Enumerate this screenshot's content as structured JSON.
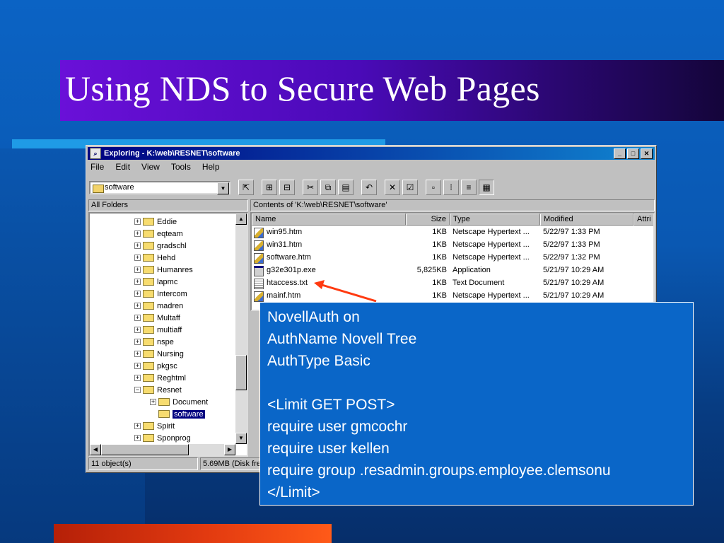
{
  "slide": {
    "title": "Using NDS to Secure Web Pages"
  },
  "window": {
    "title": "Exploring - K:\\web\\RESNET\\software",
    "minimize": "_",
    "maximize": "□",
    "close": "✕"
  },
  "menu": [
    "File",
    "Edit",
    "View",
    "Tools",
    "Help"
  ],
  "toolbar": {
    "address_value": "software"
  },
  "left_pane": {
    "header": "All Folders",
    "items": [
      {
        "label": "Eddie",
        "level": 1,
        "expander": "+",
        "selected": false
      },
      {
        "label": "eqteam",
        "level": 1,
        "expander": "+",
        "selected": false
      },
      {
        "label": "gradschl",
        "level": 1,
        "expander": "+",
        "selected": false
      },
      {
        "label": "Hehd",
        "level": 1,
        "expander": "+",
        "selected": false
      },
      {
        "label": "Humanres",
        "level": 1,
        "expander": "+",
        "selected": false
      },
      {
        "label": "lapmc",
        "level": 1,
        "expander": "+",
        "selected": false
      },
      {
        "label": "Intercom",
        "level": 1,
        "expander": "+",
        "selected": false
      },
      {
        "label": "madren",
        "level": 1,
        "expander": "+",
        "selected": false
      },
      {
        "label": "Multaff",
        "level": 1,
        "expander": "+",
        "selected": false
      },
      {
        "label": "multiaff",
        "level": 1,
        "expander": "+",
        "selected": false
      },
      {
        "label": "nspe",
        "level": 1,
        "expander": "+",
        "selected": false
      },
      {
        "label": "Nursing",
        "level": 1,
        "expander": "+",
        "selected": false
      },
      {
        "label": "pkgsc",
        "level": 1,
        "expander": "+",
        "selected": false
      },
      {
        "label": "Reghtml",
        "level": 1,
        "expander": "+",
        "selected": false
      },
      {
        "label": "Resnet",
        "level": 1,
        "expander": "−",
        "selected": false
      },
      {
        "label": "Document",
        "level": 2,
        "expander": "+",
        "selected": false
      },
      {
        "label": "software",
        "level": 2,
        "expander": "",
        "selected": true
      },
      {
        "label": "Spirit",
        "level": 1,
        "expander": "+",
        "selected": false
      },
      {
        "label": "Sponprog",
        "level": 1,
        "expander": "+",
        "selected": false
      }
    ]
  },
  "right_pane": {
    "header": "Contents of 'K:\\web\\RESNET\\software'",
    "columns": [
      "Name",
      "Size",
      "Type",
      "Modified",
      "Attri"
    ],
    "rows": [
      {
        "icon": "web",
        "name": "win95.htm",
        "size": "1KB",
        "type": "Netscape Hypertext ...",
        "modified": "5/22/97 1:33 PM"
      },
      {
        "icon": "web",
        "name": "win31.htm",
        "size": "1KB",
        "type": "Netscape Hypertext ...",
        "modified": "5/22/97 1:33 PM"
      },
      {
        "icon": "web",
        "name": "software.htm",
        "size": "1KB",
        "type": "Netscape Hypertext ...",
        "modified": "5/22/97 1:32 PM"
      },
      {
        "icon": "exe",
        "name": "g32e301p.exe",
        "size": "5,825KB",
        "type": "Application",
        "modified": "5/21/97 10:29 AM"
      },
      {
        "icon": "txt",
        "name": "htaccess.txt",
        "size": "1KB",
        "type": "Text Document",
        "modified": "5/21/97 10:29 AM"
      },
      {
        "icon": "web",
        "name": "mainf.htm",
        "size": "1KB",
        "type": "Netscape Hypertext ...",
        "modified": "5/21/97 10:29 AM"
      }
    ]
  },
  "status": {
    "objects": "11 object(s)",
    "disk": "5.69MB (Disk fre"
  },
  "callout": {
    "lines": [
      "NovellAuth on",
      "AuthName Novell Tree",
      "AuthType Basic",
      "",
      "<Limit GET POST>",
      "require user gmcochr",
      "require user kellen",
      "require group .resadmin.groups.employee.clemsonu",
      "</Limit>"
    ]
  },
  "colors": {
    "arrow": "#ff3a10",
    "title_bar": "#5a0cc8",
    "callout_bg": "#0a66c8"
  }
}
